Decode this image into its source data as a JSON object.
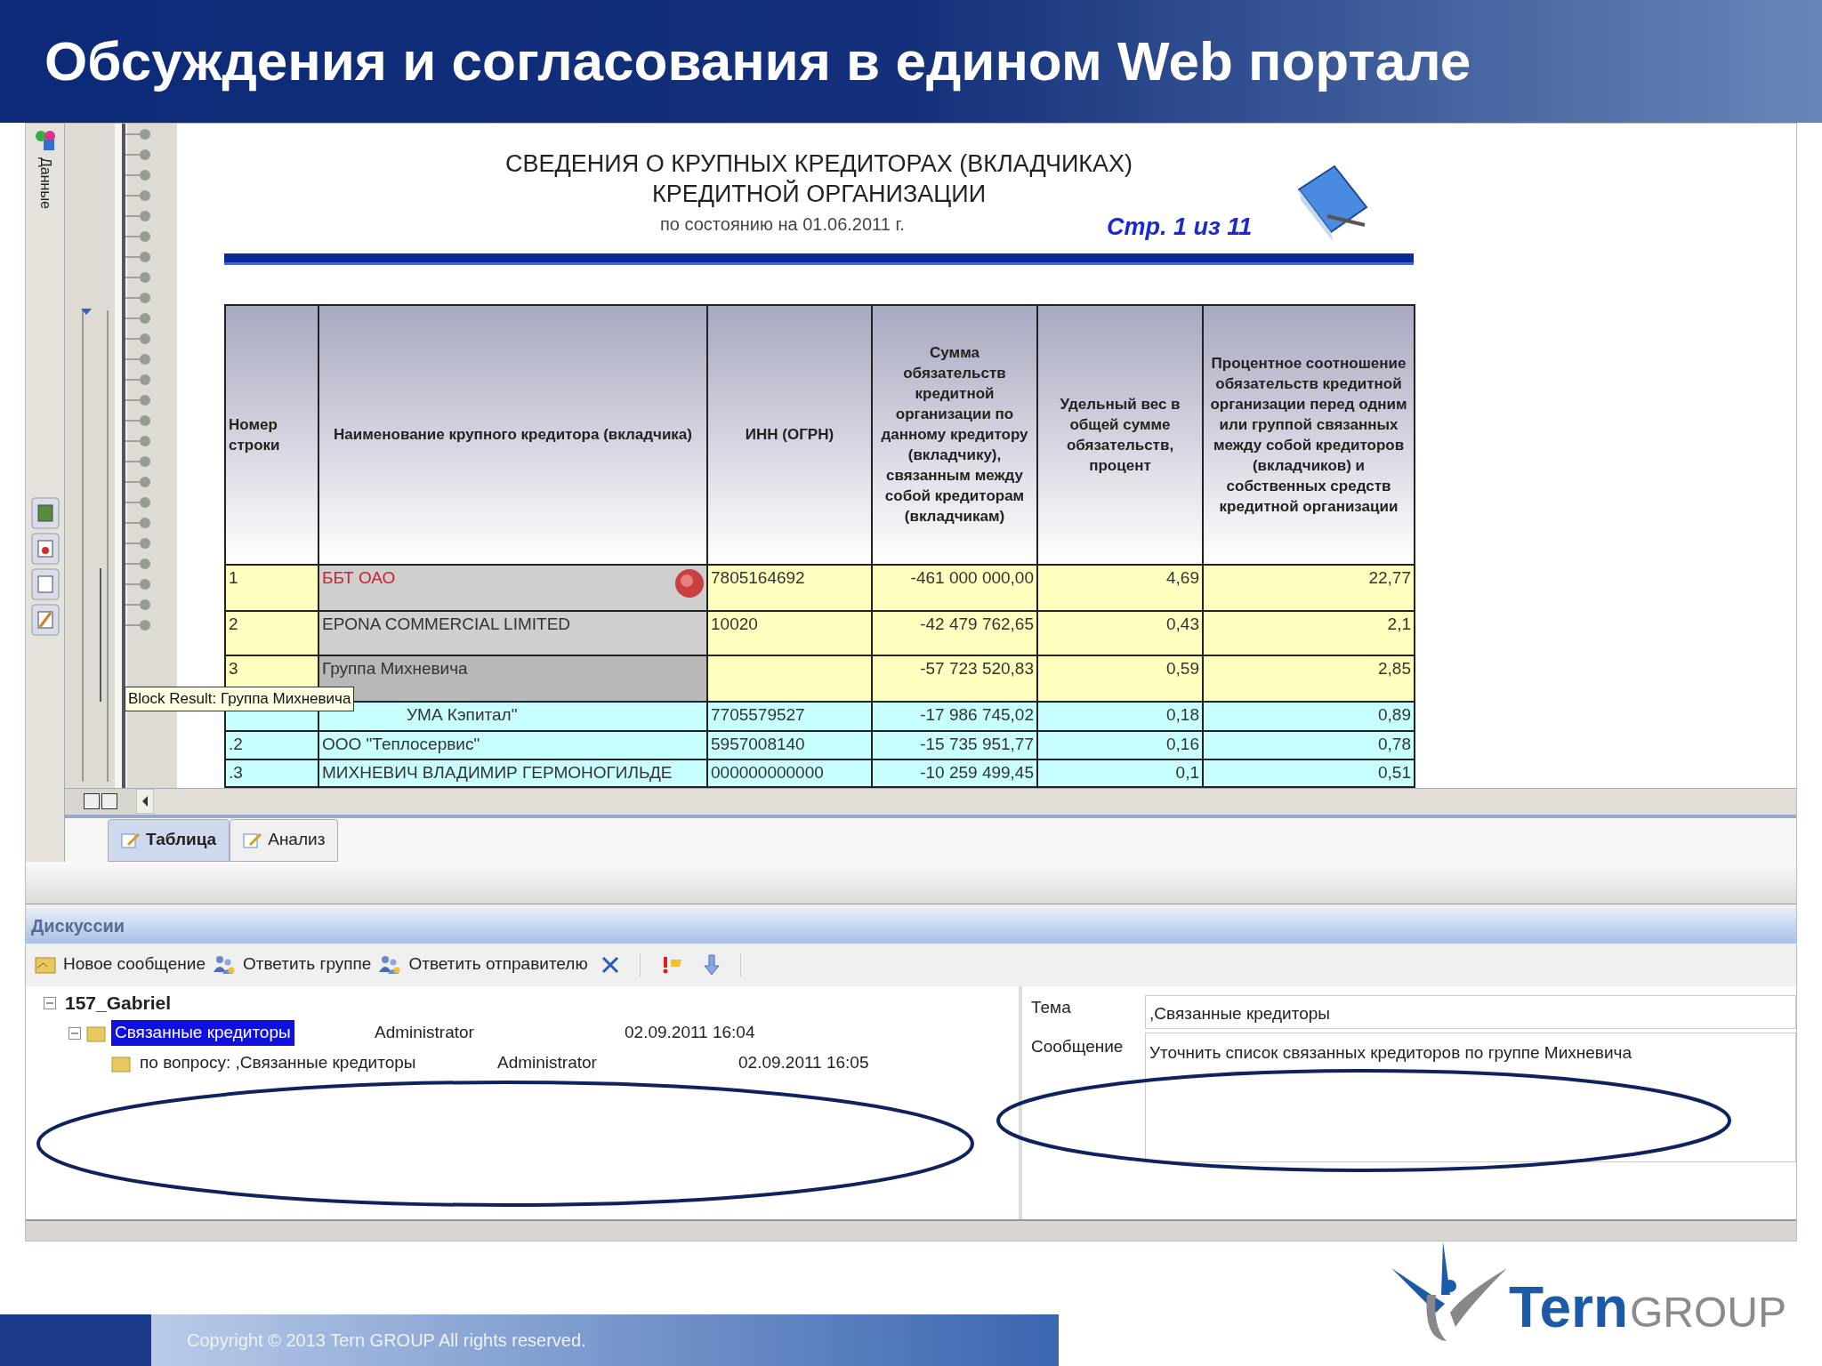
{
  "slide": {
    "title": "Обсуждения и согласования в едином Web портале",
    "footer": "Copyright © 2013 Tern GROUP All rights reserved.",
    "logo": {
      "name": "Tern",
      "suffix": "GROUP"
    }
  },
  "app": {
    "side_tab": "Данные",
    "report": {
      "title_lines": [
        "СВЕДЕНИЯ О КРУПНЫХ КРЕДИТОРАХ (ВКЛАДЧИКАХ)",
        "КРЕДИТНОЙ ОРГАНИЗАЦИИ"
      ],
      "subtitle": "по состоянию на 01.06.2011 г.",
      "page": "Стр. 1 из 11",
      "table": {
        "columns": [
          "Номер строки",
          "Наименование крупного кредитора (вкладчика)",
          "ИНН (ОГРН)",
          "Сумма обязательств кредитной организации по данному кредитору (вкладчику), связанным между собой кредиторам (вкладчикам)",
          "Удельный вес в общей сумме обязательств, процент",
          "Процентное соотношение обязательств кредитной организации перед одним или группой связанных между собой кредиторов (вкладчиков) и собственных средств кредитной организации"
        ],
        "rows": [
          {
            "kind": "group",
            "number": "1",
            "name": "ББТ ОАО",
            "flagged": true,
            "inn": "7805164692",
            "sum": "-461 000 000,00",
            "share": "4,69",
            "percent": "22,77"
          },
          {
            "kind": "group",
            "number": "2",
            "name": "EPONA COMMERCIAL LIMITED",
            "flagged": false,
            "inn": "10020",
            "sum": "-42 479 762,65",
            "share": "0,43",
            "percent": "2,1"
          },
          {
            "kind": "group",
            "number": "3",
            "name": "Группа Михневича",
            "flagged": false,
            "sum": "-57 723 520,83",
            "share": "0,59",
            "percent": "2,85"
          },
          {
            "kind": "member",
            "name": "УМА Кэпитал\"",
            "flagged": false,
            "inn": "7705579527",
            "sum": "-17 986 745,02",
            "share": "0,18",
            "percent": "0,89"
          },
          {
            "kind": "member",
            "number": ".2",
            "name": "ООО \"Теплосервис\"",
            "flagged": false,
            "inn": "5957008140",
            "sum": "-15 735 951,77",
            "share": "0,16",
            "percent": "0,78"
          },
          {
            "kind": "member",
            "number": ".3",
            "name": "МИХНЕВИЧ ВЛАДИМИР ГЕРМОНОГИЛЬДЕ",
            "flagged": false,
            "inn": "000000000000",
            "sum": "-10 259 499,45",
            "share": "0,1",
            "percent": "0,51"
          }
        ]
      }
    },
    "tooltip": "Block Result: Группа Михневича",
    "tabs": [
      {
        "label": "Таблица",
        "selected": true
      },
      {
        "label": "Анализ",
        "selected": false
      }
    ],
    "discussions": {
      "title": "Дискуссии",
      "toolbar": [
        {
          "kind": "new",
          "label": "Новое сообщение"
        },
        {
          "kind": "reply-group",
          "label": "Ответить группе"
        },
        {
          "kind": "reply-sender",
          "label": "Ответить отправителю"
        },
        {
          "kind": "delete"
        },
        {
          "kind": "flag"
        },
        {
          "kind": "down"
        }
      ],
      "tree": [
        {
          "label": "157_Gabriel",
          "expanded": true,
          "selected": false,
          "children": [
            {
              "label": "Связанные кредиторы",
              "author": "Administrator",
              "date": "02.09.2011 16:04",
              "expanded": true,
              "selected": true,
              "children": [
                {
                  "label": "по вопросу: ,Связанные кредиторы",
                  "author": "Administrator",
                  "date": "02.09.2011 16:05",
                  "selected": false
                }
              ]
            }
          ]
        }
      ],
      "form": {
        "subject_label": "Тема",
        "subject": ",Связанные кредиторы",
        "message_label": "Сообщение",
        "message": "Уточнить  список связанных кредиторов по группе Михневича"
      }
    }
  }
}
